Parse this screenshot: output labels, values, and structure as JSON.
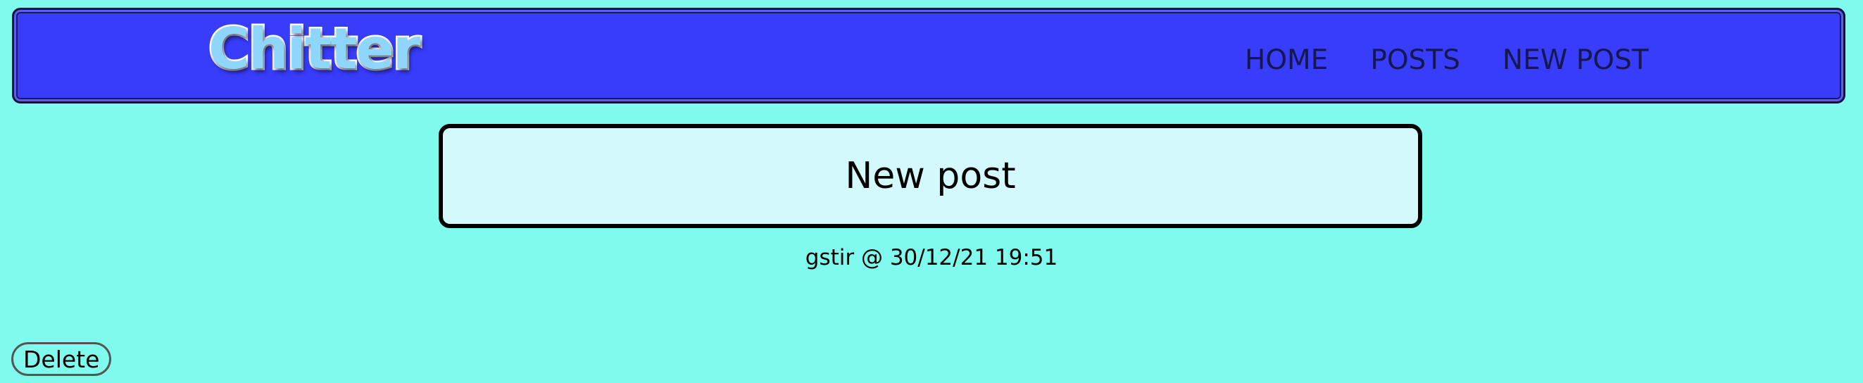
{
  "header": {
    "logo_text": "Chitter",
    "nav": [
      {
        "label": "HOME"
      },
      {
        "label": "POSTS"
      },
      {
        "label": "NEW POST"
      }
    ]
  },
  "post": {
    "title": "New post",
    "author": "gstir",
    "separator": "@",
    "timestamp": "30/12/21 19:51",
    "meta_text": "gstir @ 30/12/21 19:51",
    "delete_label": "Delete"
  },
  "colors": {
    "page_background": "#7ffaed",
    "navbar_background": "#383cfb",
    "title_box_background": "#d3f9fc",
    "logo_fill": "#8fd6ff",
    "nav_text": "#14184e"
  }
}
